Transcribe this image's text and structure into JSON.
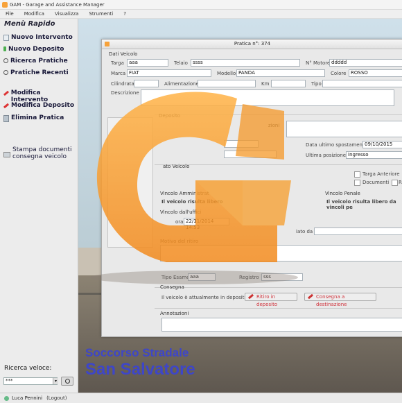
{
  "titlebar": {
    "title": "GAM - Garage and Assistance Manager"
  },
  "menubar": [
    "File",
    "Modifica",
    "Visualizza",
    "Strumenti",
    "?"
  ],
  "sidebar": {
    "title": "Menù Rapido",
    "items": [
      {
        "label": "Nuovo Intervento",
        "icon": "document-icon"
      },
      {
        "label": "Nuovo Deposito",
        "icon": "document-icon"
      },
      {
        "label": "Ricerca Pratiche",
        "icon": "search-icon"
      },
      {
        "label": "Pratiche Recenti",
        "icon": "search-icon"
      },
      {
        "label": "Modifica Intervento",
        "icon": "pencil-icon"
      },
      {
        "label": "Modifica Deposito",
        "icon": "pencil-icon"
      },
      {
        "label": "Elimina Pratica",
        "icon": "trash-icon"
      },
      {
        "label1": "Stampa documenti",
        "label2": "consegna veicolo",
        "icon": "print-icon"
      }
    ],
    "quick_search_label": "Ricerca veloce:",
    "quick_search_value": "***"
  },
  "statusbar": {
    "user": "Luca Pennini",
    "logout": "(Logout)"
  },
  "background": {
    "line1": "Soccorso Stradale",
    "line2": "San Salvatore"
  },
  "window": {
    "title": "Pratica n°: 374",
    "dati_veicolo": {
      "section": "Dati Veicolo",
      "targa_label": "Targa",
      "targa": "aaa",
      "telaio_label": "Telaio",
      "telaio": "ssss",
      "motore_label": "N° Motore",
      "motore": "ddddd",
      "marca_label": "Marca",
      "marca": "FIAT",
      "modello_label": "Modello",
      "modello": "PANDA",
      "colore_label": "Colore",
      "colore": "ROSSO",
      "cilindrata_label": "Cilindrata",
      "alimentazione_label": "Alimentazione",
      "km_label": "Km",
      "tipo_label": "Tipo",
      "descrizione_label": "Descrizione"
    },
    "deposito": {
      "section": "Deposito",
      "annotazioni_label": "zioni",
      "data_ultimo_label": "Data ultimo spostamento",
      "data_ultimo": "09/10/2015",
      "ultima_pos_label": "Ultima posizione",
      "ultima_pos": "Ingresso"
    },
    "stato_veicolo": {
      "section": "ato Veicolo",
      "targa_anteriore": "Targa Anteriore",
      "documenti": "Documenti",
      "r": "R"
    },
    "vincolo_amm": {
      "section": "Vincolo Amministrat",
      "text": "Il veicolo risulta libero"
    },
    "vincolo_penale": {
      "section": "Vincolo Penale",
      "text": "Il veicolo risulta libero da vincoli pe"
    },
    "vincolo_ufficio": {
      "section": "Vincolo dall'uffici",
      "ora_label": "ora",
      "ora": "22/11/2014 14:53",
      "dato_da_label": "iato da"
    },
    "motivo_label": "Motivo del ritiro",
    "tipo_esame_label": "Tipo Esame",
    "tipo_esame": "aaa",
    "registro_label": "Registro",
    "registro": "sss",
    "consegna": {
      "section": "Consegna",
      "text": "Il veicolo è attualmente in deposito",
      "ritiro_btn": "Ritiro in deposito",
      "destinazione_btn": "Consegna a destinazione"
    },
    "annotazioni_label": "Annotazioni"
  },
  "logo": {
    "name": "gam-logo",
    "color": "#f7a23a"
  }
}
